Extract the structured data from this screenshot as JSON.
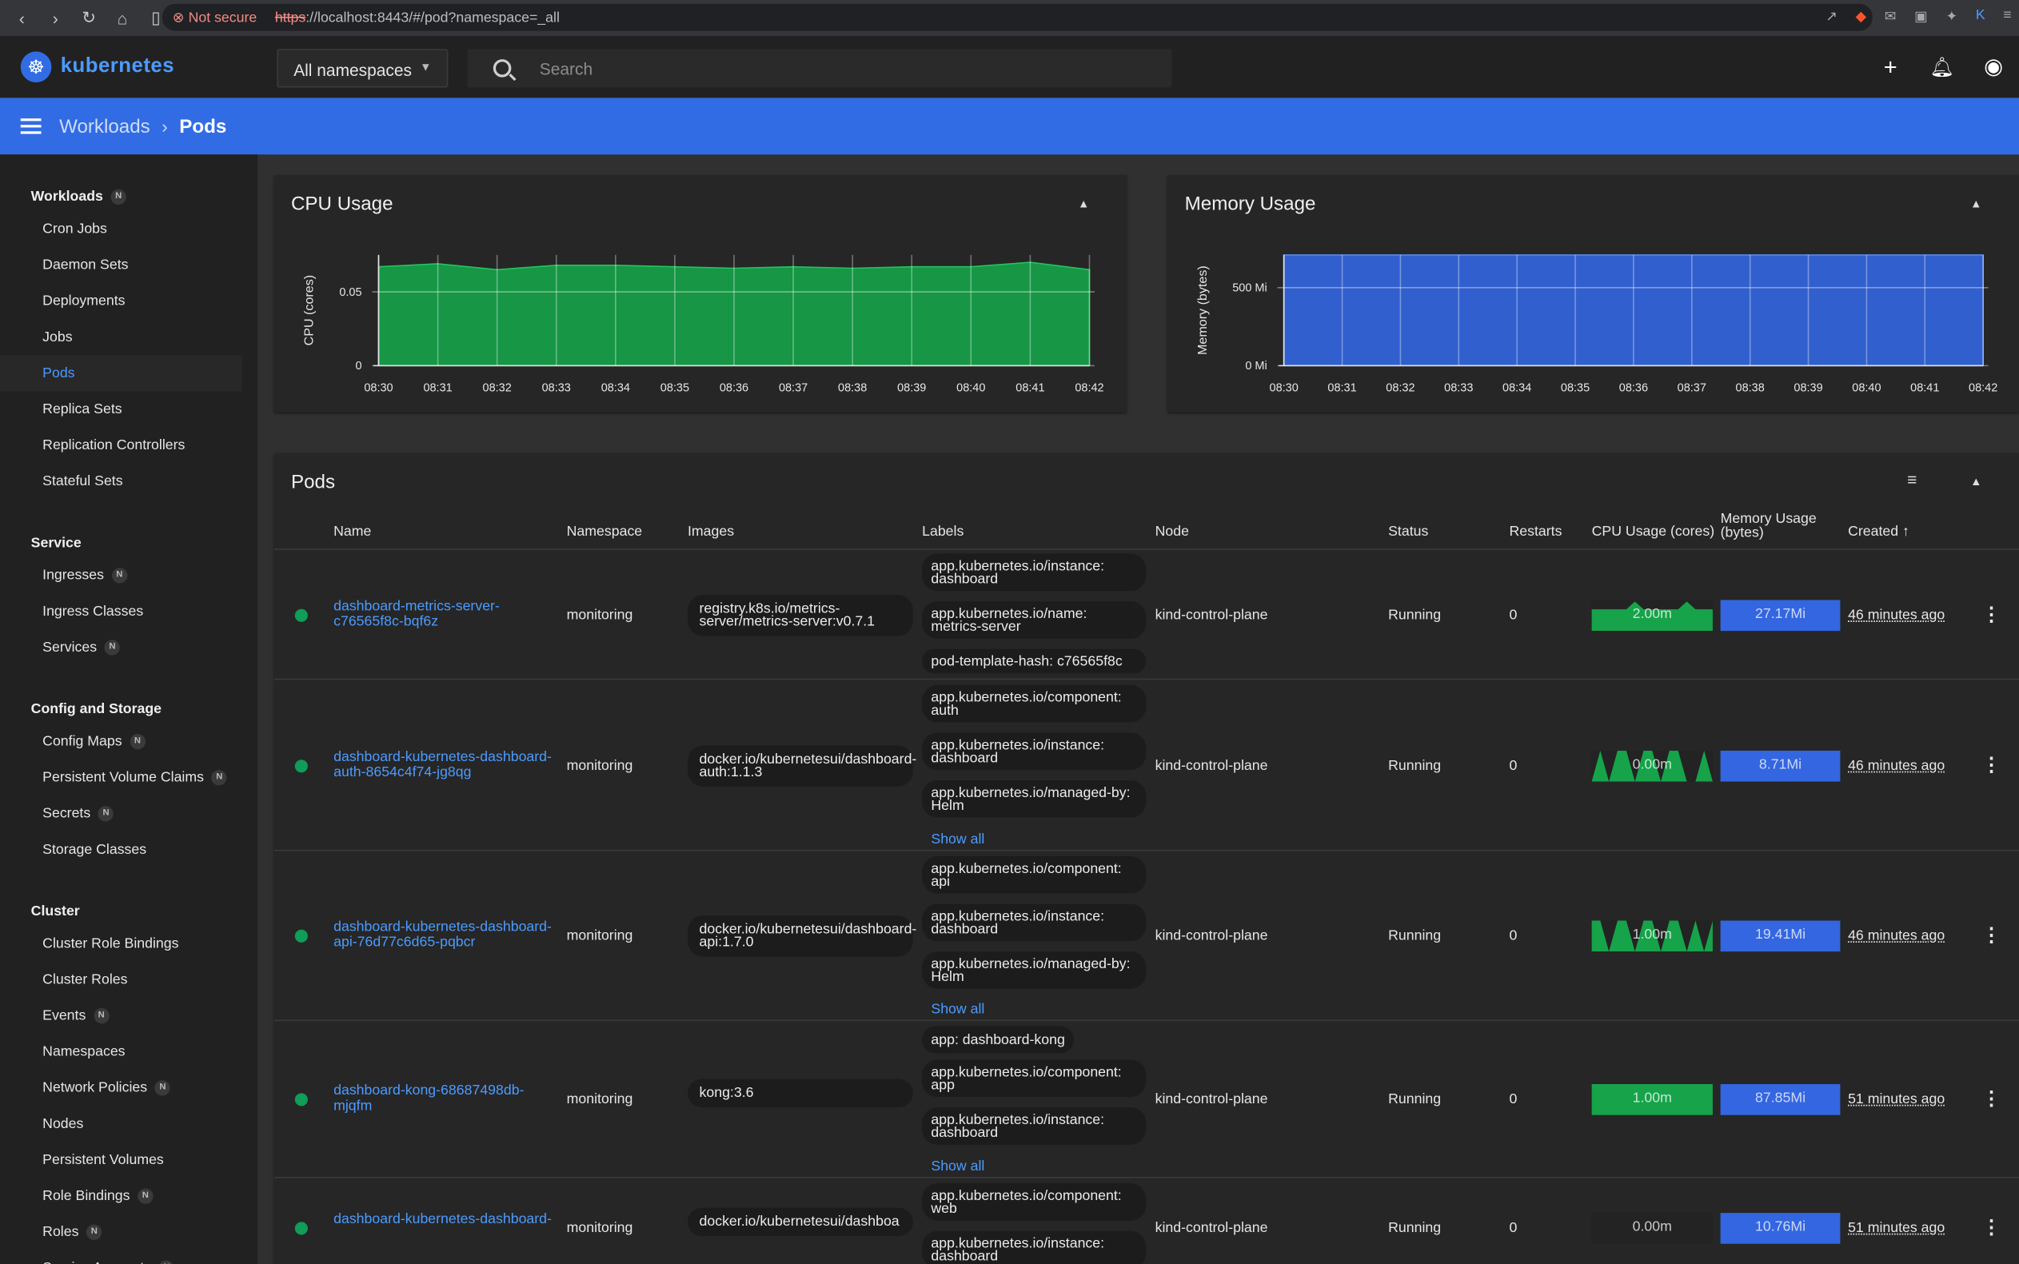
{
  "browser": {
    "warning": "Not secure",
    "url_scheme": "https",
    "url_rest": "://localhost:8443/#/pod?namespace=_all"
  },
  "app": {
    "logo_text": "kubernetes",
    "namespace": "All namespaces",
    "search_placeholder": "Search"
  },
  "breadcrumb": {
    "parent": "Workloads",
    "current": "Pods"
  },
  "colors": {
    "accent": "#326ce5",
    "cpu": "#16a34a",
    "memory": "#3366e0",
    "running": "#0f9d58"
  },
  "sidebar": [
    {
      "section": "Workloads",
      "badge": "N",
      "items": [
        {
          "label": "Cron Jobs"
        },
        {
          "label": "Daemon Sets"
        },
        {
          "label": "Deployments"
        },
        {
          "label": "Jobs"
        },
        {
          "label": "Pods",
          "active": true
        },
        {
          "label": "Replica Sets"
        },
        {
          "label": "Replication Controllers"
        },
        {
          "label": "Stateful Sets"
        }
      ]
    },
    {
      "section": "Service",
      "items": [
        {
          "label": "Ingresses",
          "badge": "N"
        },
        {
          "label": "Ingress Classes"
        },
        {
          "label": "Services",
          "badge": "N"
        }
      ]
    },
    {
      "section": "Config and Storage",
      "items": [
        {
          "label": "Config Maps",
          "badge": "N"
        },
        {
          "label": "Persistent Volume Claims",
          "badge": "N"
        },
        {
          "label": "Secrets",
          "badge": "N"
        },
        {
          "label": "Storage Classes"
        }
      ]
    },
    {
      "section": "Cluster",
      "items": [
        {
          "label": "Cluster Role Bindings"
        },
        {
          "label": "Cluster Roles"
        },
        {
          "label": "Events",
          "badge": "N"
        },
        {
          "label": "Namespaces"
        },
        {
          "label": "Network Policies",
          "badge": "N"
        },
        {
          "label": "Nodes"
        },
        {
          "label": "Persistent Volumes"
        },
        {
          "label": "Role Bindings",
          "badge": "N"
        },
        {
          "label": "Roles",
          "badge": "N"
        },
        {
          "label": "Service Accounts",
          "badge": "N"
        }
      ]
    }
  ],
  "cpu_card": {
    "title": "CPU Usage"
  },
  "memory_card": {
    "title": "Memory Usage"
  },
  "chart_data": [
    {
      "type": "area",
      "title": "CPU Usage",
      "ylabel": "CPU (cores)",
      "xlabel": "",
      "x": [
        "08:30",
        "08:31",
        "08:32",
        "08:33",
        "08:34",
        "08:35",
        "08:36",
        "08:37",
        "08:38",
        "08:39",
        "08:40",
        "08:41",
        "08:42"
      ],
      "yticks": [
        "0",
        "0.05"
      ],
      "ylim": [
        0,
        0.075
      ],
      "series": [
        {
          "values": [
            0.067,
            0.069,
            0.065,
            0.068,
            0.068,
            0.067,
            0.066,
            0.067,
            0.066,
            0.067,
            0.067,
            0.07,
            0.065
          ]
        }
      ],
      "grid": true
    },
    {
      "type": "area",
      "title": "Memory Usage",
      "ylabel": "Memory (bytes)",
      "xlabel": "",
      "x": [
        "08:30",
        "08:31",
        "08:32",
        "08:33",
        "08:34",
        "08:35",
        "08:36",
        "08:37",
        "08:38",
        "08:39",
        "08:40",
        "08:41",
        "08:42"
      ],
      "yticks": [
        "0 Mi",
        "500 Mi"
      ],
      "ylim": [
        0,
        710
      ],
      "series": [
        {
          "values": [
            710,
            710,
            710,
            710,
            710,
            710,
            710,
            710,
            710,
            710,
            710,
            710,
            710
          ]
        }
      ],
      "grid": true
    }
  ],
  "pods": {
    "title": "Pods",
    "columns": [
      "Name",
      "Namespace",
      "Images",
      "Labels",
      "Node",
      "Status",
      "Restarts",
      "CPU Usage (cores)",
      "Memory Usage (bytes)",
      "Created"
    ],
    "show_all": "Show all",
    "rows": [
      {
        "name": "dashboard-metrics-server-c76565f8c-bqf6z",
        "namespace": "monitoring",
        "image": "registry.k8s.io/metrics-server/metrics-server:v0.7.1",
        "labels": [
          "app.kubernetes.io/instance: dashboard",
          "app.kubernetes.io/name: metrics-server",
          "pod-template-hash: c76565f8c"
        ],
        "node": "kind-control-plane",
        "status": "Running",
        "restarts": "0",
        "cpu": "2.00m",
        "memory": "27.17Mi",
        "created": "46 minutes ago",
        "cpu_trend": [
          0.7,
          0.7,
          0.7,
          0.7,
          0.7,
          0.95,
          0.7,
          0.7,
          0.7,
          0.7,
          0.7,
          0.95,
          0.7,
          0.7,
          0.7
        ],
        "mem_fill": 1.0
      },
      {
        "name": "dashboard-kubernetes-dashboard-auth-8654c4f74-jg8qg",
        "namespace": "monitoring",
        "image": "docker.io/kubernetesui/dashboard-auth:1.1.3",
        "labels": [
          "app.kubernetes.io/component: auth",
          "app.kubernetes.io/instance: dashboard",
          "app.kubernetes.io/managed-by: Helm"
        ],
        "node": "kind-control-plane",
        "status": "Running",
        "restarts": "0",
        "cpu": "0.00m",
        "memory": "8.71Mi",
        "created": "46 minutes ago",
        "cpu_trend": [
          0,
          1,
          0,
          1,
          1,
          0,
          1,
          1,
          0,
          1,
          1,
          0,
          0,
          1,
          0
        ],
        "mem_fill": 1.0
      },
      {
        "name": "dashboard-kubernetes-dashboard-api-76d77c6d65-pqbcr",
        "namespace": "monitoring",
        "image": "docker.io/kubernetesui/dashboard-api:1.7.0",
        "labels": [
          "app.kubernetes.io/component: api",
          "app.kubernetes.io/instance: dashboard",
          "app.kubernetes.io/managed-by: Helm"
        ],
        "node": "kind-control-plane",
        "status": "Running",
        "restarts": "0",
        "cpu": "1.00m",
        "memory": "19.41Mi",
        "created": "46 minutes ago",
        "cpu_trend": [
          1,
          1,
          0,
          1,
          1,
          0,
          1,
          1,
          0,
          1,
          1,
          0,
          1,
          0,
          1
        ],
        "mem_fill": 1.0
      },
      {
        "name": "dashboard-kong-68687498db-mjqfm",
        "namespace": "monitoring",
        "image": "kong:3.6",
        "labels": [
          "app: dashboard-kong",
          "app.kubernetes.io/component: app",
          "app.kubernetes.io/instance: dashboard"
        ],
        "node": "kind-control-plane",
        "status": "Running",
        "restarts": "0",
        "cpu": "1.00m",
        "memory": "87.85Mi",
        "created": "51 minutes ago",
        "cpu_trend": [
          1,
          1,
          1,
          1,
          1,
          1,
          1,
          1,
          1,
          1,
          1,
          1,
          1,
          1,
          1
        ],
        "mem_fill": 1.0
      },
      {
        "name": "dashboard-kubernetes-dashboard-",
        "namespace": "monitoring",
        "image": "docker.io/kubernetesui/dashboa",
        "labels": [
          "app.kubernetes.io/component: web",
          "app.kubernetes.io/instance: dashboard"
        ],
        "node": "kind-control-plane",
        "status": "Running",
        "restarts": "0",
        "cpu": "0.00m",
        "memory": "10.76Mi",
        "created": "51 minutes ago",
        "cpu_trend": [
          0,
          0,
          0,
          0,
          0,
          0,
          0,
          0,
          0,
          0,
          0,
          0,
          0,
          0,
          0
        ],
        "mem_fill": 1.0
      }
    ]
  }
}
